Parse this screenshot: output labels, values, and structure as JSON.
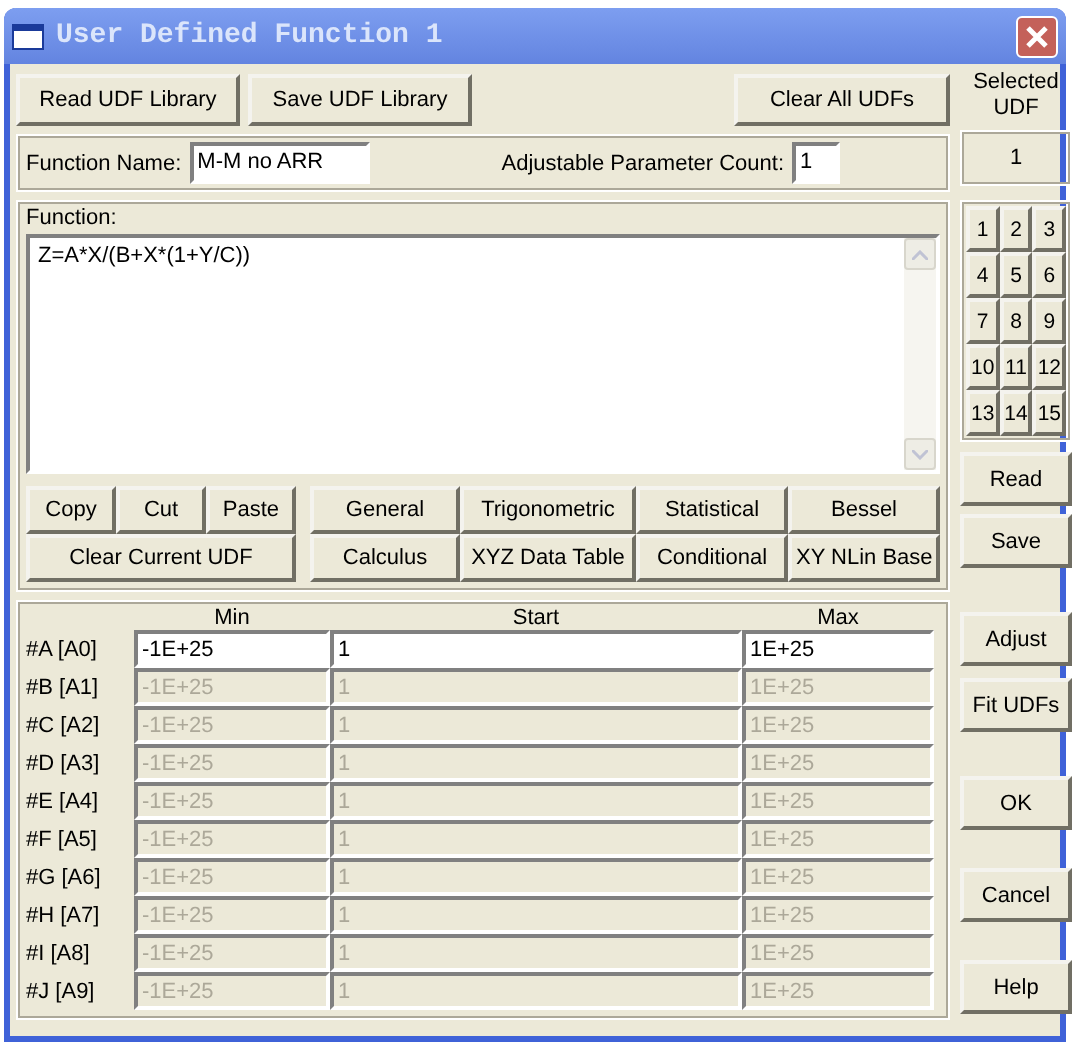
{
  "window": {
    "title": "User Defined Function 1"
  },
  "library_buttons": [
    "Read UDF Library",
    "Save UDF Library"
  ],
  "clear_all_button": "Clear All UDFs",
  "selected_udf": {
    "label": "Selected UDF",
    "value": "1"
  },
  "function_name": {
    "label": "Function Name:",
    "value": "M-M no ARR"
  },
  "parameter_count": {
    "label": "Adjustable Parameter Count:",
    "value": "1"
  },
  "function": {
    "label": "Function:",
    "value": "Z=A*X/(B+X*(1+Y/C))"
  },
  "edit_buttons": [
    "Copy",
    "Cut",
    "Paste"
  ],
  "clear_current_button": "Clear Current UDF",
  "category_buttons": [
    "General",
    "Trigonometric",
    "Statistical",
    "Bessel",
    "Calculus",
    "XYZ Data Table",
    "Conditional",
    "XY NLin Base"
  ],
  "udf_numbers": [
    "1",
    "2",
    "3",
    "4",
    "5",
    "6",
    "7",
    "8",
    "9",
    "10",
    "11",
    "12",
    "13",
    "14",
    "15"
  ],
  "udf_buttons": [
    "Read",
    "Save"
  ],
  "parameters": {
    "columns": [
      "Min",
      "Start",
      "Max"
    ],
    "rows": [
      {
        "label": "#A [A0]",
        "min": "-1E+25",
        "start": "1",
        "max": "1E+25",
        "disabled": false
      },
      {
        "label": "#B [A1]",
        "min": "-1E+25",
        "start": "1",
        "max": "1E+25",
        "disabled": true
      },
      {
        "label": "#C [A2]",
        "min": "-1E+25",
        "start": "1",
        "max": "1E+25",
        "disabled": true
      },
      {
        "label": "#D [A3]",
        "min": "-1E+25",
        "start": "1",
        "max": "1E+25",
        "disabled": true
      },
      {
        "label": "#E [A4]",
        "min": "-1E+25",
        "start": "1",
        "max": "1E+25",
        "disabled": true
      },
      {
        "label": "#F [A5]",
        "min": "-1E+25",
        "start": "1",
        "max": "1E+25",
        "disabled": true
      },
      {
        "label": "#G [A6]",
        "min": "-1E+25",
        "start": "1",
        "max": "1E+25",
        "disabled": true
      },
      {
        "label": "#H [A7]",
        "min": "-1E+25",
        "start": "1",
        "max": "1E+25",
        "disabled": true
      },
      {
        "label": "#I [A8]",
        "min": "-1E+25",
        "start": "1",
        "max": "1E+25",
        "disabled": true
      },
      {
        "label": "#J [A9]",
        "min": "-1E+25",
        "start": "1",
        "max": "1E+25",
        "disabled": true
      }
    ]
  },
  "action_buttons": [
    "Adjust",
    "Fit UDFs"
  ],
  "dialog_buttons": [
    "OK",
    "Cancel",
    "Help"
  ]
}
